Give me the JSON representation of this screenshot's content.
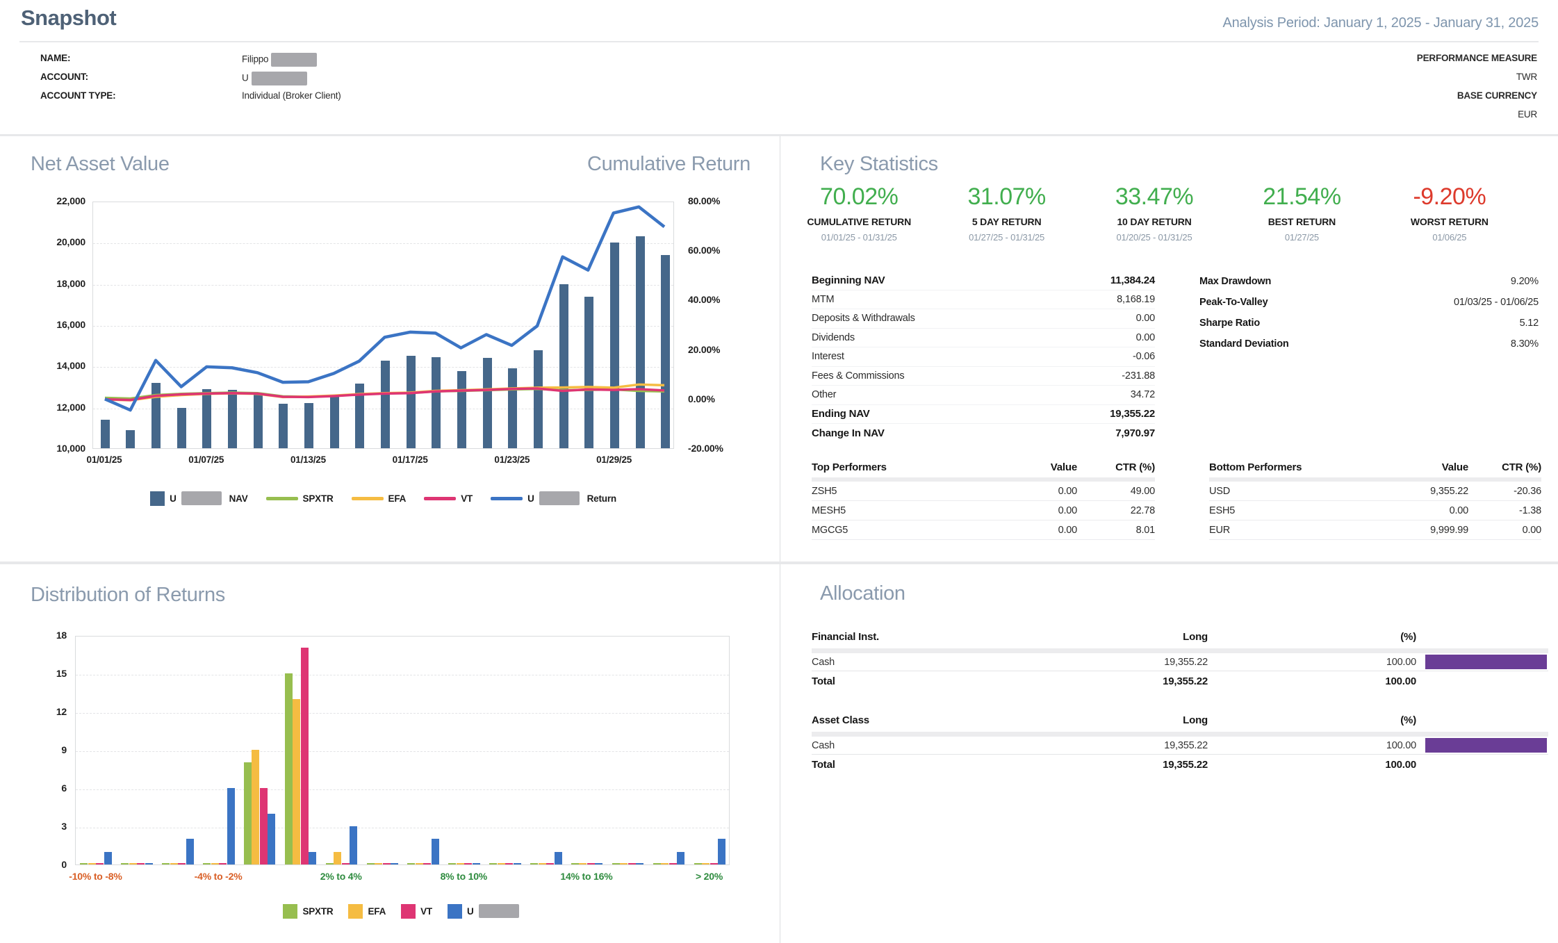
{
  "header": {
    "title": "Snapshot",
    "analysis_period": "Analysis Period: January 1, 2025 - January 31, 2025"
  },
  "account": {
    "name_label": "NAME:",
    "name_value": "Filippo",
    "name_redacted": true,
    "account_label": "ACCOUNT:",
    "account_value": "U",
    "account_redacted": true,
    "type_label": "ACCOUNT TYPE:",
    "type_value": "Individual (Broker Client)",
    "perf_label": "PERFORMANCE MEASURE",
    "perf_value": "TWR",
    "currency_label": "BASE CURRENCY",
    "currency_value": "EUR"
  },
  "nav_panel": {
    "title_left": "Net Asset Value",
    "title_right": "Cumulative Return"
  },
  "chart_data": [
    {
      "id": "nav_cumulative_return",
      "type": "bar",
      "title": "Net Asset Value / Cumulative Return",
      "x": [
        "01/01/25",
        "01/02/25",
        "01/03/25",
        "01/06/25",
        "01/07/25",
        "01/08/25",
        "01/09/25",
        "01/10/25",
        "01/13/25",
        "01/14/25",
        "01/15/25",
        "01/16/25",
        "01/17/25",
        "01/20/25",
        "01/21/25",
        "01/22/25",
        "01/23/25",
        "01/24/25",
        "01/27/25",
        "01/28/25",
        "01/29/25",
        "01/30/25",
        "01/31/25"
      ],
      "x_tick_indices": [
        0,
        4,
        8,
        12,
        16,
        20
      ],
      "x_tick_labels": [
        "01/01/25",
        "01/07/25",
        "01/13/25",
        "01/17/25",
        "01/23/25",
        "01/29/25"
      ],
      "left_axis": {
        "min": 10000,
        "max": 22000,
        "ticks": [
          "22,000",
          "20,000",
          "18,000",
          "16,000",
          "14,000",
          "12,000",
          "10,000"
        ]
      },
      "right_axis": {
        "min": -20,
        "max": 80,
        "ticks": [
          "80.00%",
          "60.00%",
          "40.00%",
          "20.00%",
          "0.00%",
          "-20.00%"
        ]
      },
      "grid": true,
      "legend_position": "bottom",
      "bar_series": {
        "name": "U NAV",
        "color": "#45678a",
        "values": [
          11384,
          10870,
          13170,
          11958,
          12880,
          12830,
          12600,
          12160,
          12180,
          12570,
          13140,
          14240,
          14480,
          14430,
          13750,
          14370,
          13870,
          14760,
          17960,
          17350,
          19990,
          20270,
          19355
        ]
      },
      "line_series": [
        {
          "name": "SPXTR",
          "color": "#97be4f",
          "axis": "right",
          "values": [
            0.5,
            0.2,
            1.6,
            2.1,
            2.4,
            2.6,
            2.4,
            1.1,
            0.9,
            1.3,
            1.9,
            2.3,
            2.5,
            3.1,
            3.3,
            3.6,
            3.9,
            4.1,
            3.6,
            3.7,
            3.9,
            3.3,
            3.1
          ]
        },
        {
          "name": "EFA",
          "color": "#f5bc42",
          "axis": "right",
          "values": [
            -0.2,
            -0.5,
            0.9,
            1.6,
            2.1,
            2.3,
            2.1,
            0.8,
            1.0,
            1.4,
            2.0,
            2.4,
            2.6,
            3.3,
            3.6,
            3.9,
            4.3,
            4.6,
            4.7,
            4.9,
            4.6,
            5.9,
            5.6
          ]
        },
        {
          "name": "VT",
          "color": "#de3573",
          "axis": "right",
          "values": [
            -0.1,
            -0.4,
            1.3,
            1.9,
            2.2,
            2.4,
            2.2,
            0.9,
            0.8,
            1.2,
            1.8,
            2.2,
            2.4,
            3.1,
            3.4,
            3.7,
            4.1,
            4.3,
            3.3,
            3.9,
            3.7,
            4.0,
            3.5
          ]
        },
        {
          "name": "U Return",
          "color": "#3b74c4",
          "axis": "right",
          "values": [
            0.0,
            -4.5,
            15.7,
            5.0,
            13.1,
            12.7,
            10.7,
            6.8,
            7.0,
            10.4,
            15.4,
            25.1,
            27.2,
            26.8,
            20.8,
            26.2,
            21.8,
            29.7,
            57.8,
            52.4,
            75.6,
            78.1,
            70.0
          ]
        }
      ],
      "legend": [
        {
          "swatch": "square",
          "color": "#45678a",
          "pre": "U",
          "redacted": true,
          "post": "NAV"
        },
        {
          "swatch": "line",
          "color": "#97be4f",
          "post": "SPXTR"
        },
        {
          "swatch": "line",
          "color": "#f5bc42",
          "post": "EFA"
        },
        {
          "swatch": "line",
          "color": "#de3573",
          "post": "VT"
        },
        {
          "swatch": "line",
          "color": "#3b74c4",
          "pre": "U",
          "redacted": true,
          "post": "Return"
        }
      ]
    },
    {
      "id": "distribution_of_returns",
      "type": "bar",
      "title": "Distribution of Returns",
      "categories": [
        "-10% to -8%",
        "-8% to -6%",
        "-6% to -4%",
        "-4% to -2%",
        "-2% to 0%",
        "0% to 2%",
        "2% to 4%",
        "4% to 6%",
        "6% to 8%",
        "8% to 10%",
        "10% to 12%",
        "12% to 14%",
        "14% to 16%",
        "16% to 18%",
        "18% to 20%",
        "> 20%"
      ],
      "x_label_indices": [
        0,
        3,
        6,
        9,
        12,
        15
      ],
      "x_label_colors": [
        "#d95f26",
        "#d95f26",
        "#2e8b3e",
        "#2e8b3e",
        "#2e8b3e",
        "#2e8b3e"
      ],
      "ylim": [
        0,
        18
      ],
      "yticks": [
        "0",
        "3",
        "6",
        "9",
        "12",
        "15",
        "18"
      ],
      "grid": true,
      "legend_position": "bottom",
      "series": [
        {
          "name": "SPXTR",
          "color": "#97be4f",
          "values": [
            0,
            0,
            0,
            0,
            8,
            15,
            0,
            0,
            0,
            0,
            0,
            0,
            0,
            0,
            0,
            0
          ]
        },
        {
          "name": "EFA",
          "color": "#f5bc42",
          "values": [
            0,
            0,
            0,
            0,
            9,
            13,
            1,
            0,
            0,
            0,
            0,
            0,
            0,
            0,
            0,
            0
          ]
        },
        {
          "name": "VT",
          "color": "#de3573",
          "values": [
            0,
            0,
            0,
            0,
            6,
            17,
            0,
            0,
            0,
            0,
            0,
            0,
            0,
            0,
            0,
            0
          ]
        },
        {
          "name": "U",
          "color": "#3b74c4",
          "redacted": true,
          "values": [
            1,
            0,
            2,
            6,
            4,
            1,
            3,
            0,
            2,
            0,
            0,
            1,
            0,
            0,
            1,
            2
          ]
        }
      ],
      "legend": [
        {
          "swatch": "square",
          "color": "#97be4f",
          "post": "SPXTR"
        },
        {
          "swatch": "square",
          "color": "#f5bc42",
          "post": "EFA"
        },
        {
          "swatch": "square",
          "color": "#de3573",
          "post": "VT"
        },
        {
          "swatch": "square",
          "color": "#3b74c4",
          "pre": "U",
          "redacted": true,
          "post": ""
        }
      ]
    }
  ],
  "key_stats": {
    "title": "Key Statistics",
    "green": "#41ae4e",
    "red": "#dd3a2c",
    "highlights": [
      {
        "value": "70.02%",
        "label": "CUMULATIVE RETURN",
        "dates": "01/01/25 - 01/31/25",
        "color": "#41ae4e"
      },
      {
        "value": "31.07%",
        "label": "5 DAY RETURN",
        "dates": "01/27/25 - 01/31/25",
        "color": "#41ae4e"
      },
      {
        "value": "33.47%",
        "label": "10 DAY RETURN",
        "dates": "01/20/25 - 01/31/25",
        "color": "#41ae4e"
      },
      {
        "value": "21.54%",
        "label": "BEST RETURN",
        "dates": "01/27/25",
        "color": "#41ae4e"
      },
      {
        "value": "-9.20%",
        "label": "WORST RETURN",
        "dates": "01/06/25",
        "color": "#dd3a2c"
      }
    ],
    "nav_table": [
      {
        "label": "Beginning NAV",
        "value": "11,384.24",
        "bold": true
      },
      {
        "label": "MTM",
        "value": "8,168.19",
        "bold": false
      },
      {
        "label": "Deposits & Withdrawals",
        "value": "0.00",
        "bold": false
      },
      {
        "label": "Dividends",
        "value": "0.00",
        "bold": false
      },
      {
        "label": "Interest",
        "value": "-0.06",
        "bold": false
      },
      {
        "label": "Fees & Commissions",
        "value": "-231.88",
        "bold": false
      },
      {
        "label": "Other",
        "value": "34.72",
        "bold": false
      },
      {
        "label": "Ending NAV",
        "value": "19,355.22",
        "bold": true
      },
      {
        "label": "Change In NAV",
        "value": "7,970.97",
        "bold": true
      }
    ],
    "risk_table": [
      {
        "label": "Max Drawdown",
        "value": "9.20%"
      },
      {
        "label": "Peak-To-Valley",
        "value": "01/03/25 - 01/06/25"
      },
      {
        "label": "Sharpe Ratio",
        "value": "5.12"
      },
      {
        "label": "Standard Deviation",
        "value": "8.30%"
      }
    ],
    "top_performers": {
      "title": "Top Performers",
      "col_value": "Value",
      "col_ctr": "CTR (%)",
      "rows": [
        [
          "ZSH5",
          "0.00",
          "49.00"
        ],
        [
          "MESH5",
          "0.00",
          "22.78"
        ],
        [
          "MGCG5",
          "0.00",
          "8.01"
        ]
      ]
    },
    "bottom_performers": {
      "title": "Bottom Performers",
      "col_value": "Value",
      "col_ctr": "CTR (%)",
      "rows": [
        [
          "USD",
          "9,355.22",
          "-20.36"
        ],
        [
          "ESH5",
          "0.00",
          "-1.38"
        ],
        [
          "EUR",
          "9,999.99",
          "0.00"
        ]
      ]
    }
  },
  "allocation": {
    "title": "Allocation",
    "bar_color": "#6a3d96",
    "tables": [
      {
        "header": "Financial Inst.",
        "col_long": "Long",
        "col_pct": "(%)",
        "rows": [
          {
            "label": "Cash",
            "long": "19,355.22",
            "pct": "100.00",
            "bar_pct": 100
          }
        ],
        "total": {
          "label": "Total",
          "long": "19,355.22",
          "pct": "100.00"
        }
      },
      {
        "header": "Asset Class",
        "col_long": "Long",
        "col_pct": "(%)",
        "rows": [
          {
            "label": "Cash",
            "long": "19,355.22",
            "pct": "100.00",
            "bar_pct": 100
          }
        ],
        "total": {
          "label": "Total",
          "long": "19,355.22",
          "pct": "100.00"
        }
      }
    ]
  }
}
